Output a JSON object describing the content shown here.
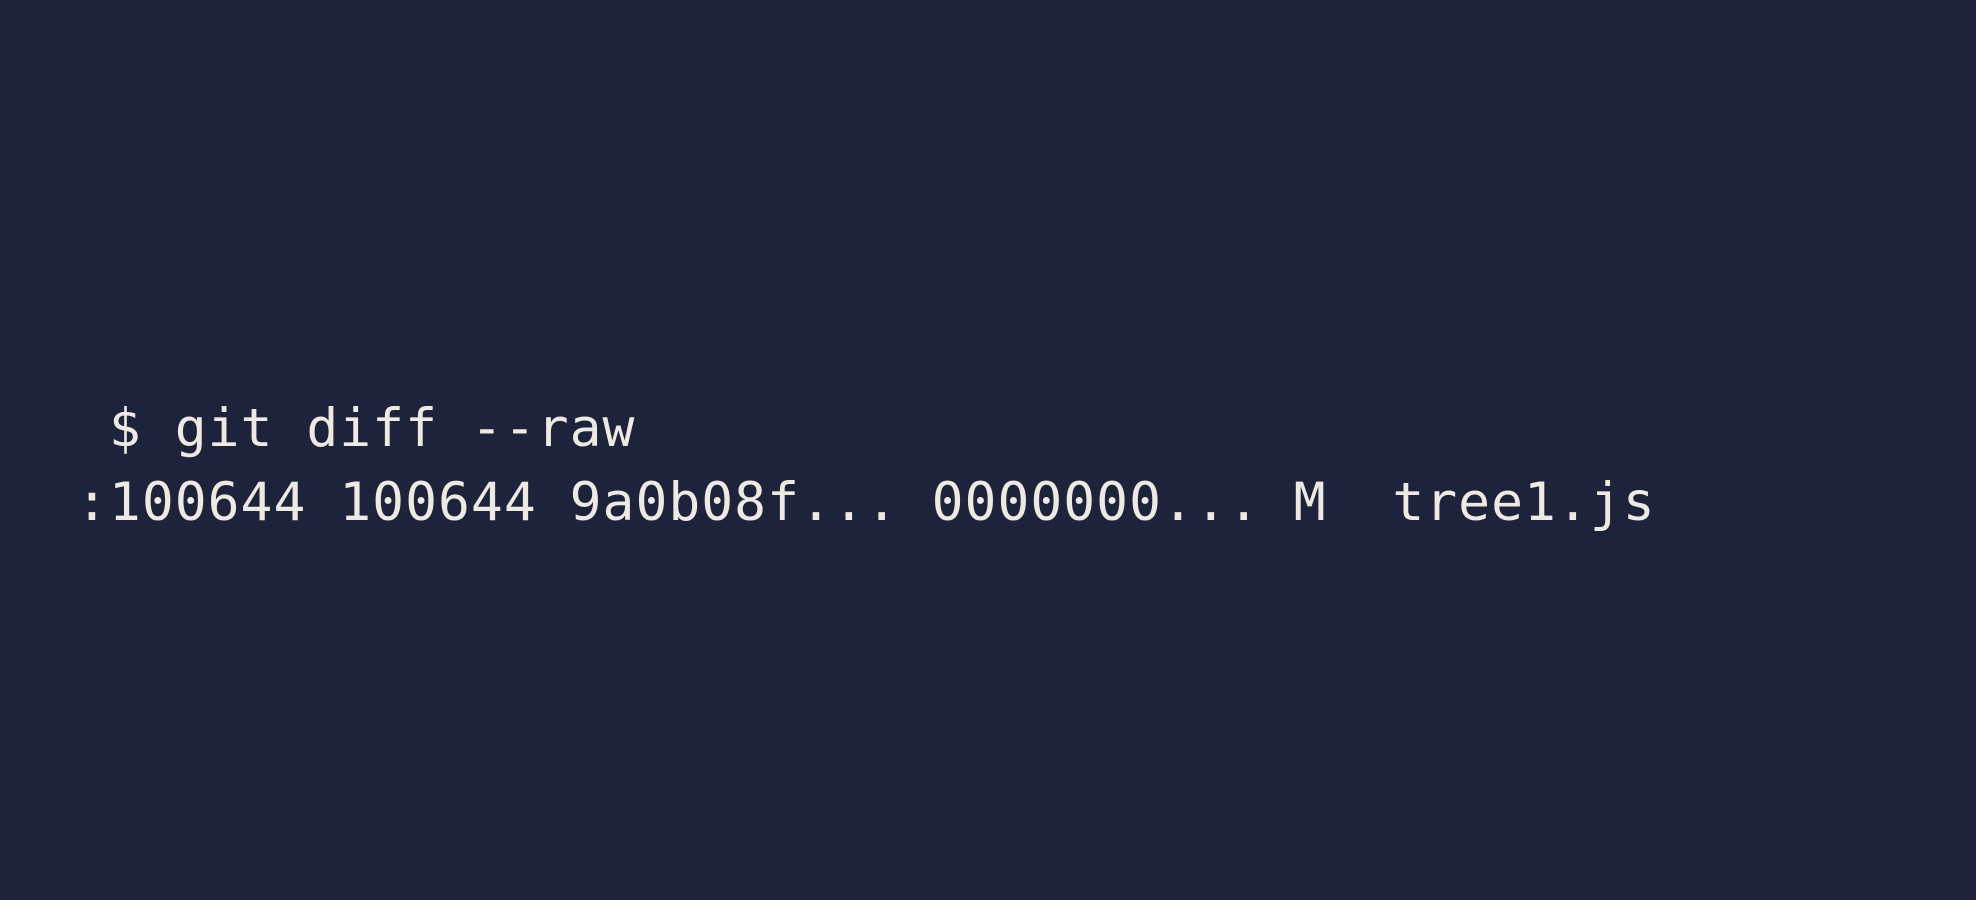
{
  "terminal": {
    "background_color": "#1e233c",
    "text_color": "#eceae2",
    "lines": [
      " $ git diff --raw",
      ":100644 100644 9a0b08f... 0000000... M  tree1.js"
    ]
  }
}
